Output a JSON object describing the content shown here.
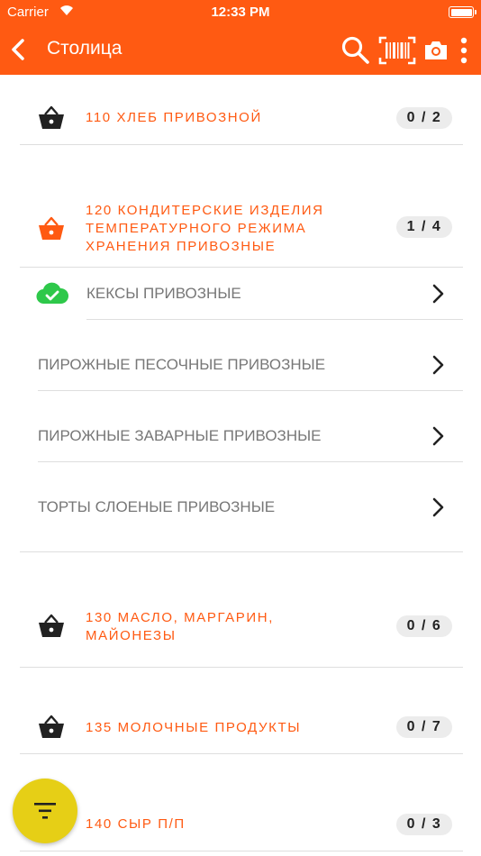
{
  "status": {
    "carrier": "Carrier",
    "time": "12:33 PM"
  },
  "nav": {
    "title": "Столица",
    "icons": [
      "back-arrow-icon",
      "search-icon",
      "barcode-icon",
      "camera-icon",
      "more-vert-icon"
    ]
  },
  "colors": {
    "accent": "#ff5a12",
    "success": "#2ec84a",
    "fab": "#e6cf16"
  },
  "categories": [
    {
      "title": "110 ХЛЕБ ПРИВОЗНОЙ",
      "count": "0 / 2",
      "icon": "basket-icon"
    },
    {
      "title": "120 КОНДИТЕРСКИЕ ИЗДЕЛИЯ ТЕМПЕРАТУРНОГО РЕЖИМА ХРАНЕНИЯ ПРИВОЗНЫЕ",
      "count": "1 / 4",
      "icon": "basket-icon"
    },
    {
      "title": "130 МАСЛО, МАРГАРИН, МАЙОНЕЗЫ",
      "count": "0 / 6",
      "icon": "basket-icon"
    },
    {
      "title": "135 МОЛОЧНЫЕ ПРОДУКТЫ",
      "count": "0 / 7",
      "icon": "basket-icon"
    },
    {
      "title": "140 СЫР П/П",
      "count": "0 / 3",
      "icon": "basket-icon"
    }
  ],
  "subitems": [
    {
      "label": "КЕКСЫ ПРИВОЗНЫЕ",
      "done": true
    },
    {
      "label": "ПИРОЖНЫЕ ПЕСОЧНЫЕ ПРИВОЗНЫЕ",
      "done": false
    },
    {
      "label": "ПИРОЖНЫЕ ЗАВАРНЫЕ ПРИВОЗНЫЕ",
      "done": false
    },
    {
      "label": "ТОРТЫ СЛОЕНЫЕ ПРИВОЗНЫЕ",
      "done": false
    }
  ]
}
